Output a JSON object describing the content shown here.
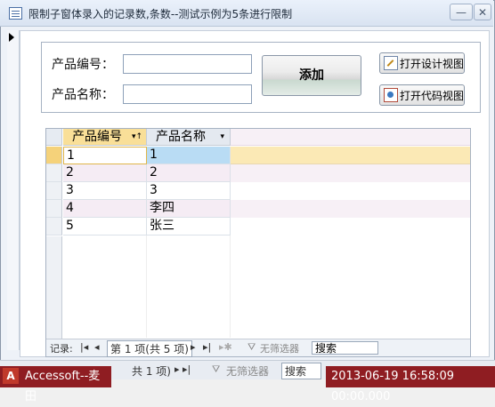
{
  "window": {
    "title": "限制子窗体录入的记录数,条数--测试示例为5条进行限制",
    "minimize": "—",
    "close": "✕"
  },
  "form": {
    "code_label": "产品编号：",
    "name_label": "产品名称：",
    "code_value": "",
    "name_value": "",
    "add_label": "添加",
    "design_view_label": "打开设计视图",
    "code_view_label": "打开代码视图"
  },
  "datasheet": {
    "columns": [
      "产品编号",
      "产品名称"
    ],
    "rows": [
      [
        "1",
        "1"
      ],
      [
        "2",
        "2"
      ],
      [
        "3",
        "3"
      ],
      [
        "4",
        "李四"
      ],
      [
        "5",
        "张三"
      ]
    ]
  },
  "subform_nav": {
    "record_label": "记录:",
    "position": "第 1 项(共 5 项)",
    "filter": "无筛选器",
    "search": "搜索"
  },
  "main_nav": {
    "position": "共 1 项)",
    "filter": "无筛选器",
    "search": "搜索"
  },
  "taskbar": {
    "app_label": "Accessoft--麦田",
    "logo": "A",
    "datetime": "2013-06-19 16:58:09 00:00.000"
  },
  "colors": {
    "current_row": "#fbe9b5",
    "current_cell": "#b9dcf4",
    "alt_row": "#f5ecf4",
    "taskbar": "#8f1d22"
  }
}
